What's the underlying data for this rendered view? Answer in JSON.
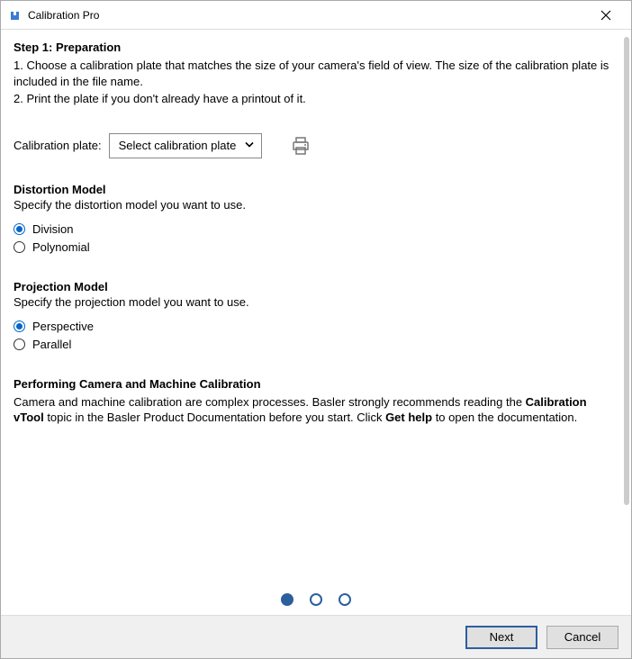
{
  "window": {
    "title": "Calibration Pro"
  },
  "step": {
    "heading": "Step 1: Preparation",
    "line1": "1. Choose a calibration plate that matches the size of your camera's field of view. The size of the calibration plate is included in the file name.",
    "line2": "2. Print the plate if you don't already have a printout of it."
  },
  "plate": {
    "label": "Calibration plate:",
    "selected": "Select calibration plate"
  },
  "distortion": {
    "heading": "Distortion Model",
    "sub": "Specify the distortion model you want to use.",
    "opt1": "Division",
    "opt2": "Polynomial"
  },
  "projection": {
    "heading": "Projection Model",
    "sub": "Specify the projection model you want to use.",
    "opt1": "Perspective",
    "opt2": "Parallel"
  },
  "info": {
    "heading": "Performing Camera and Machine Calibration",
    "text_a": "Camera and machine calibration are complex processes. Basler strongly recommends reading the ",
    "bold1": "Calibration vTool",
    "text_b": " topic in the Basler Product Documentation before you start. Click ",
    "bold2": "Get help",
    "text_c": " to open the documentation."
  },
  "footer": {
    "next": "Next",
    "cancel": "Cancel"
  }
}
